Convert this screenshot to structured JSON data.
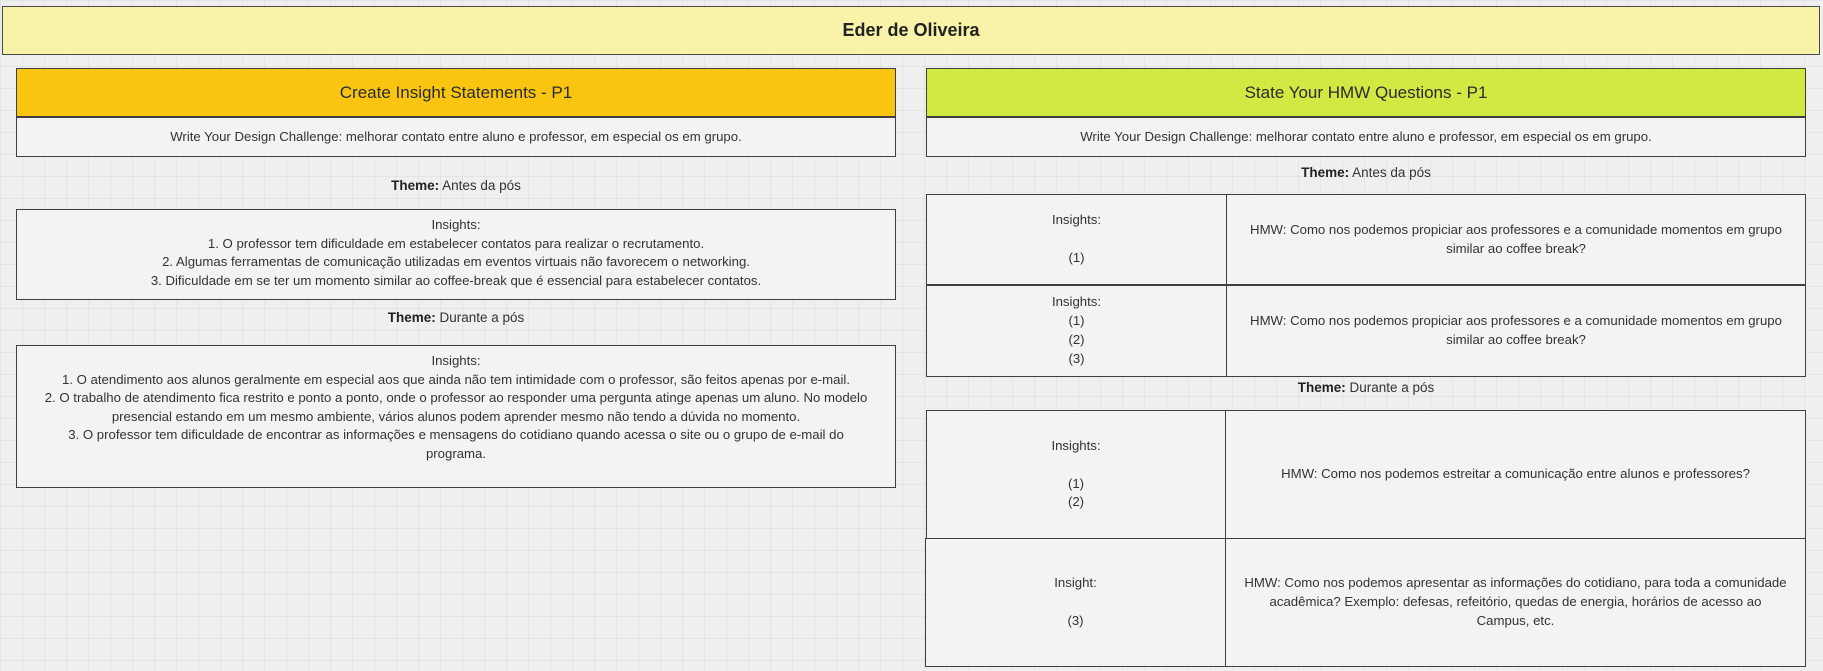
{
  "board_title": "Eder de Oliveira",
  "left": {
    "header": "Create Insight Statements - P1",
    "challenge": "Write Your Design Challenge: melhorar contato entre aluno e professor, em especial os em grupo.",
    "theme1": {
      "label": "Theme:",
      "value": "Antes da pós"
    },
    "insights1": {
      "title": "Insights:",
      "items": [
        "1. O professor tem dificuldade em estabelecer contatos para realizar o recrutamento.",
        "2. Algumas ferramentas de comunicação utilizadas em eventos virtuais não favorecem o networking.",
        "3. Dificuldade em se ter um momento similar ao coffee-break que é essencial para estabelecer contatos."
      ]
    },
    "theme2": {
      "label": "Theme:",
      "value": "Durante a pós"
    },
    "insights2": {
      "title": "Insights:",
      "items": [
        "1. O atendimento aos alunos geralmente em especial aos que ainda não tem intimidade com o professor, são feitos apenas por e-mail.",
        "2. O trabalho de atendimento fica restrito e ponto a ponto, onde o professor ao responder uma pergunta atinge apenas um aluno. No modelo presencial estando em um mesmo ambiente, vários alunos podem aprender mesmo não tendo a dúvida no momento.",
        "3. O professor tem dificuldade de encontrar as informações e mensagens do cotidiano quando acessa o site ou o grupo de e-mail do programa."
      ]
    }
  },
  "right": {
    "header": "State Your HMW Questions - P1",
    "challenge": "Write Your Design Challenge: melhorar contato entre aluno e professor, em especial os em grupo.",
    "theme1": {
      "label": "Theme:",
      "value": "Antes da pós"
    },
    "theme2": {
      "label": "Theme:",
      "value": "Durante a pós"
    },
    "rows": [
      {
        "insight_label": "Insights:",
        "refs": [
          "(1)"
        ],
        "hmw": "HMW:  Como nos podemos propiciar  aos professores e a comunidade momentos em grupo similar ao coffee break?"
      },
      {
        "insight_label": "Insights:",
        "refs": [
          "(1)",
          "(2)",
          "(3)"
        ],
        "hmw": "HMW:  Como nos podemos propiciar  aos professores e a comunidade momentos em grupo similar ao coffee break?"
      },
      {
        "insight_label": "Insights:",
        "refs": [
          "(1)",
          "(2)"
        ],
        "hmw": "HMW: Como nos podemos estreitar a comunicação entre alunos e professores?"
      },
      {
        "insight_label": "Insight:",
        "refs": [
          "(3)"
        ],
        "hmw": "HMW: Como nos podemos apresentar as informações do cotidiano, para toda a comunidade acadêmica? Exemplo: defesas, refeitório, quedas de energia, horários de acesso ao Campus, etc."
      }
    ]
  }
}
